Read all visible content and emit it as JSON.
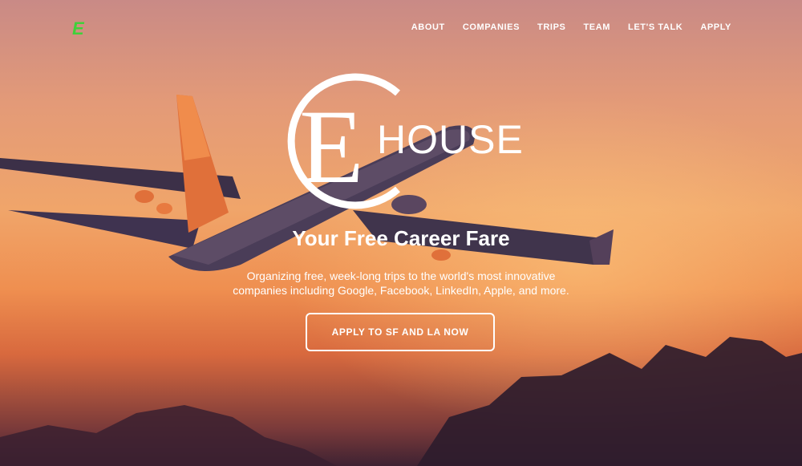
{
  "nav": {
    "logo_letter": "E",
    "items": [
      "ABOUT",
      "COMPANIES",
      "TRIPS",
      "TEAM",
      "LET'S TALK",
      "APPLY"
    ]
  },
  "brand": {
    "letter": "E",
    "word": "HOUSE"
  },
  "hero": {
    "tagline": "Your Free Career Fare",
    "description_line1": "Organizing free, week-long trips to the world's most innovative",
    "description_line2": "companies including Google, Facebook, LinkedIn, Apple, and more.",
    "cta_label": "APPLY TO SF AND LA NOW"
  },
  "colors": {
    "logo_green": "#3fd13a",
    "text": "#ffffff",
    "sky_top": "#c98a86",
    "sky_mid": "#f0a56a",
    "sky_bottom": "#3e2232"
  }
}
